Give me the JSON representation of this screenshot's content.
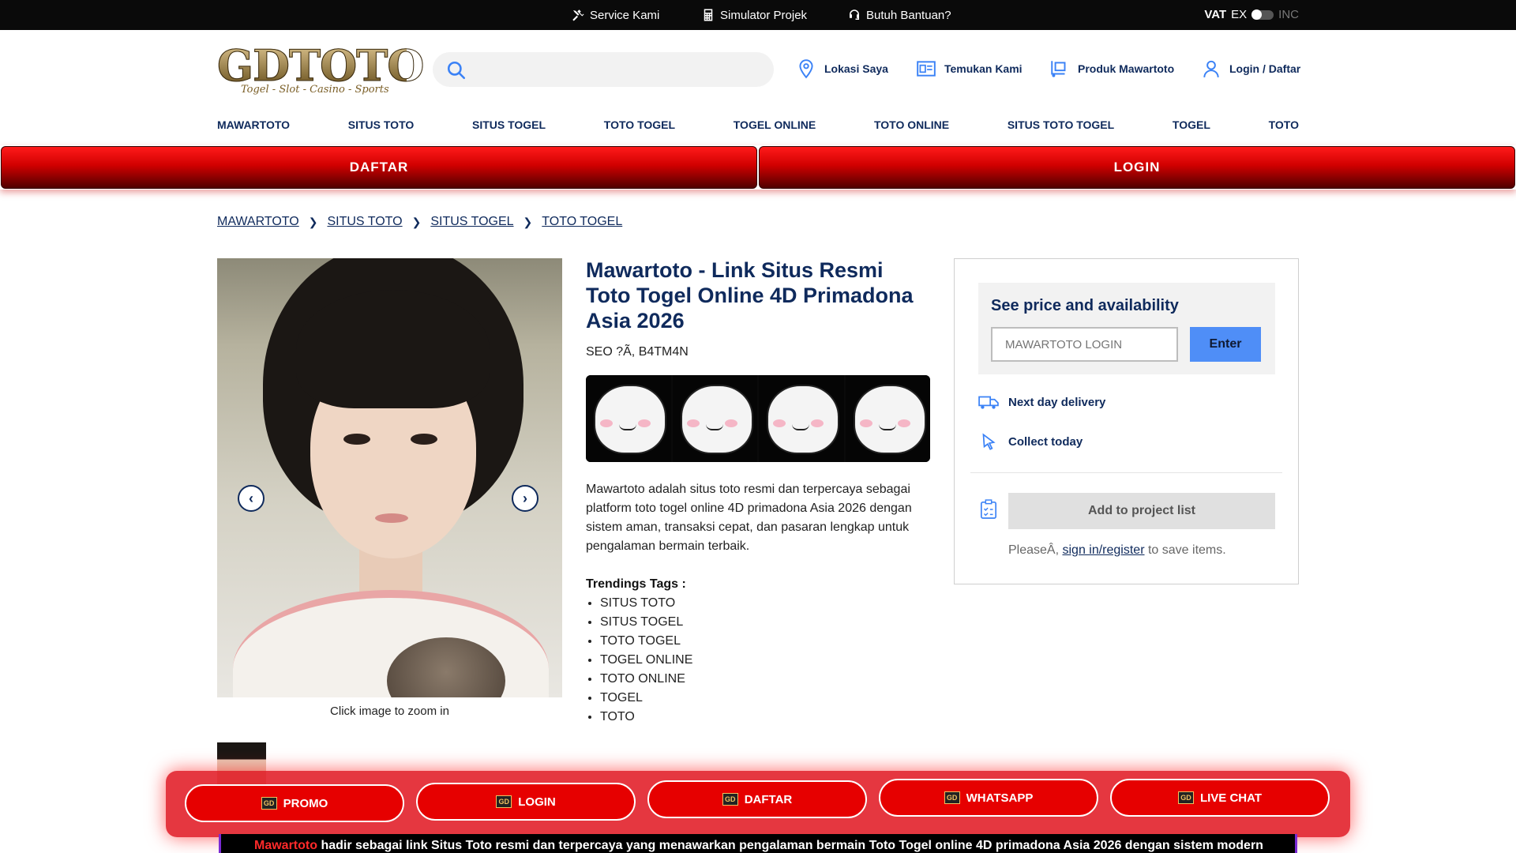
{
  "topbar": {
    "service": "Service Kami",
    "simulator": "Simulator Projek",
    "help": "Butuh Bantuan?",
    "vat_label": "VAT",
    "vat_ex": "EX",
    "vat_inc": "INC"
  },
  "logo": {
    "main": "GDTOTO",
    "sub": "Togel - Slot - Casino - Sports"
  },
  "header": {
    "location": "Lokasi Saya",
    "find": "Temukan Kami",
    "product": "Produk Mawartoto",
    "login": "Login / Daftar"
  },
  "categories": [
    "MAWARTOTO",
    "SITUS TOTO",
    "SITUS TOGEL",
    "TOTO TOGEL",
    "TOGEL ONLINE",
    "TOTO ONLINE",
    "SITUS TOTO TOGEL",
    "TOGEL",
    "TOTO"
  ],
  "redbar": {
    "daftar": "DAFTAR",
    "login": "LOGIN"
  },
  "breadcrumb": [
    "MAWARTOTO",
    "SITUS TOTO",
    "SITUS TOGEL",
    "TOTO TOGEL"
  ],
  "product": {
    "zoom_hint": "Click image to zoom in",
    "title": "Mawartoto - Link Situs Resmi Toto Togel Online 4D Primadona Asia 2026",
    "seo": "SEO ?Ã, B4TM4N",
    "description": "Mawartoto adalah situs toto resmi dan terpercaya sebagai platform toto togel online 4D primadona Asia 2026 dengan sistem aman, transaksi cepat, dan pasaran lengkap untuk pengalaman bermain terbaik.",
    "tags_title": "Trendings Tags :",
    "tags": [
      "SITUS TOTO",
      "SITUS TOGEL",
      "TOTO TOGEL",
      "TOGEL ONLINE",
      "TOTO ONLINE",
      "TOGEL",
      "TOTO"
    ]
  },
  "pricebox": {
    "heading": "See price and availability",
    "input_placeholder": "MAWARTOTO LOGIN",
    "enter": "Enter",
    "delivery": "Next day delivery",
    "collect": "Collect today",
    "add": "Add to project list",
    "please_prefix": "PleaseÂ, ",
    "please_link": "sign in/register",
    "please_suffix": " to save items."
  },
  "floatbar": {
    "promo": "PROMO",
    "login": "LOGIN",
    "daftar": "DAFTAR",
    "whatsapp": "WHATSAPP",
    "livechat": "LIVE CHAT",
    "badge": "GD"
  },
  "bottom": {
    "brand": "Mawartoto",
    "text": " hadir sebagai link Situs Toto resmi dan terpercaya yang menawarkan pengalaman bermain Toto Togel online 4D primadona Asia 2026 dengan sistem modern"
  }
}
